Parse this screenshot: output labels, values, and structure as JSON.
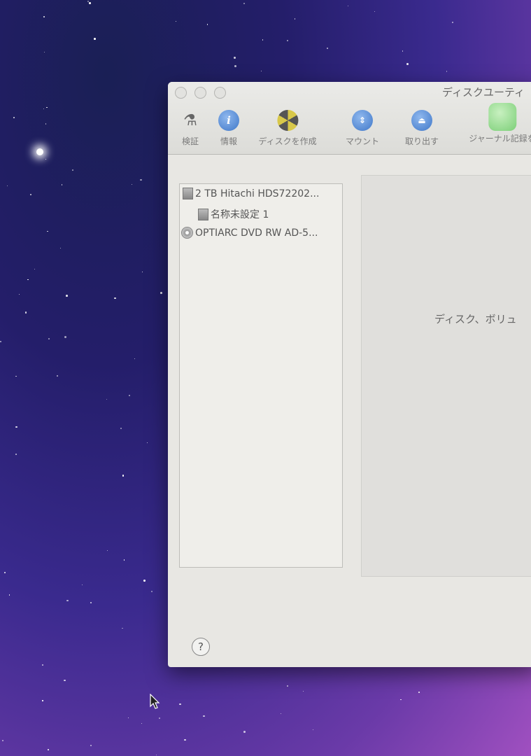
{
  "window": {
    "title": "ディスクユーティ"
  },
  "toolbar": [
    {
      "label": "検証",
      "icon": "microscope-icon"
    },
    {
      "label": "情報",
      "icon": "info-icon"
    },
    {
      "label": "ディスクを作成",
      "icon": "burn-icon"
    },
    {
      "label": "マウント",
      "icon": "mount-icon"
    },
    {
      "label": "取り出す",
      "icon": "eject-icon"
    },
    {
      "label": "ジャーナル記録を",
      "icon": "journal-icon"
    }
  ],
  "sidebar": {
    "items": [
      {
        "label": "2 TB Hitachi HDS72202..."
      },
      {
        "label": "名称未設定 1"
      },
      {
        "label": "OPTIARC DVD RW AD-5..."
      }
    ]
  },
  "main": {
    "message": "ディスク、ボリュ"
  },
  "help": {
    "label": "?"
  }
}
